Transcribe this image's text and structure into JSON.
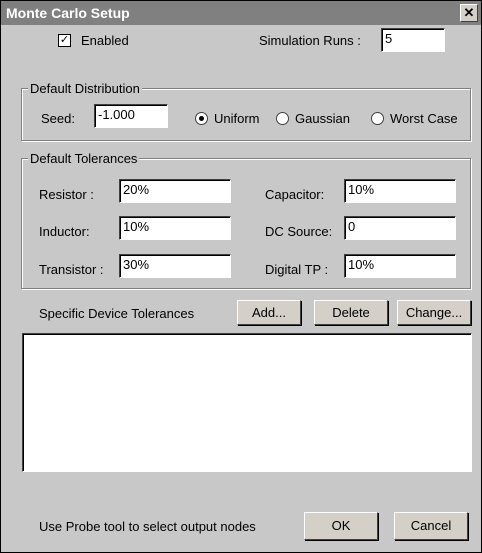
{
  "window": {
    "title": "Monte Carlo Setup",
    "close_glyph": "✕"
  },
  "enabled": {
    "label": "Enabled",
    "checked": true,
    "check_glyph": "✓"
  },
  "simulation_runs": {
    "label": "Simulation Runs :",
    "value": "5"
  },
  "default_distribution": {
    "legend": "Default Distribution",
    "seed_label": "Seed:",
    "seed_value": "-1.000",
    "options": [
      "Uniform",
      "Gaussian",
      "Worst Case"
    ],
    "selected": "Uniform"
  },
  "default_tolerances": {
    "legend": "Default Tolerances",
    "resistor": {
      "label": "Resistor :",
      "value": "20%"
    },
    "inductor": {
      "label": "Inductor:",
      "value": "10%"
    },
    "transistor": {
      "label": "Transistor :",
      "value": "30%"
    },
    "capacitor": {
      "label": "Capacitor:",
      "value": "10%"
    },
    "dc_source": {
      "label": "DC Source:",
      "value": "0"
    },
    "digital_tp": {
      "label": "Digital TP :",
      "value": "10%"
    }
  },
  "specific": {
    "label": "Specific Device Tolerances",
    "add": "Add...",
    "delete": "Delete",
    "change": "Change..."
  },
  "footer": {
    "hint": "Use Probe tool to select output nodes",
    "ok": "OK",
    "cancel": "Cancel"
  }
}
